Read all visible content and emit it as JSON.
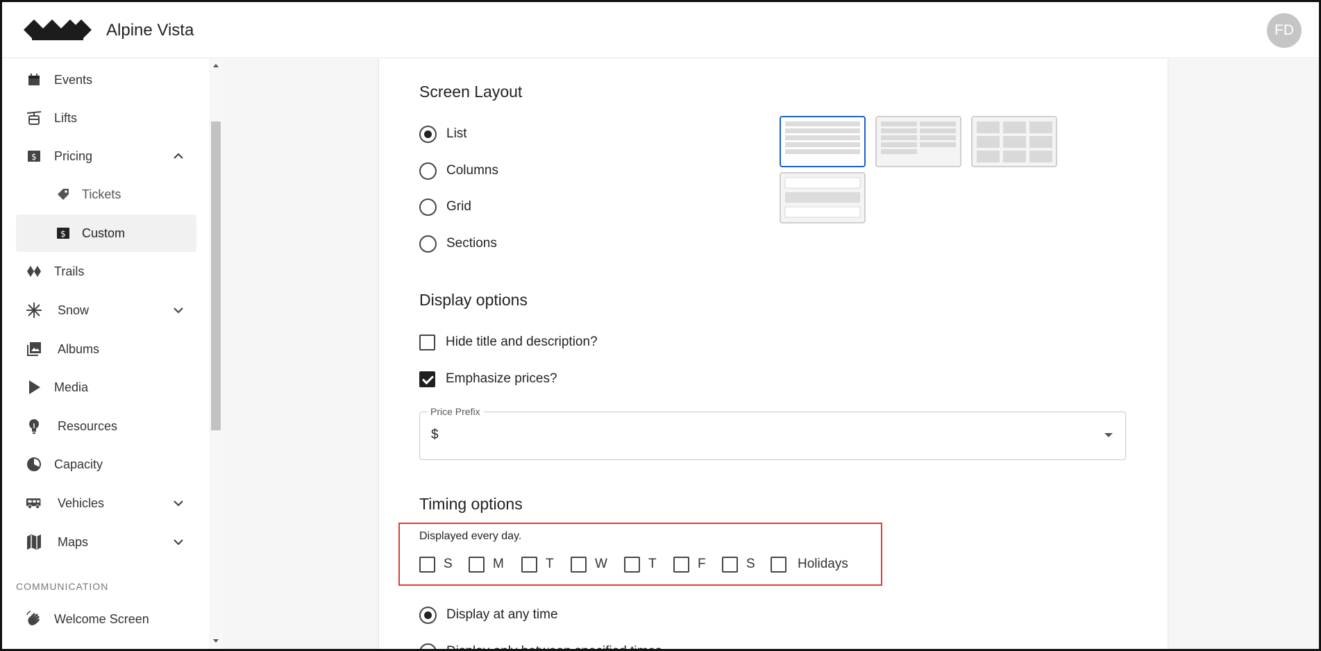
{
  "app": {
    "brand": "Alpine Vista",
    "user_initials": "FD"
  },
  "sidebar": {
    "items": [
      {
        "label": "Events",
        "icon": "calendar-icon"
      },
      {
        "label": "Lifts",
        "icon": "gondola-icon"
      },
      {
        "label": "Pricing",
        "icon": "dollar-icon",
        "expanded": true
      },
      {
        "label": "Tickets",
        "icon": "tag-icon"
      },
      {
        "label": "Custom",
        "icon": "dollar-icon",
        "active": true
      },
      {
        "label": "Trails",
        "icon": "trails-icon"
      },
      {
        "label": "Snow",
        "icon": "snowflake-icon"
      },
      {
        "label": "Albums",
        "icon": "photo-icon"
      },
      {
        "label": "Media",
        "icon": "play-icon"
      },
      {
        "label": "Resources",
        "icon": "lightbulb-icon"
      },
      {
        "label": "Capacity",
        "icon": "gauge-icon"
      },
      {
        "label": "Vehicles",
        "icon": "bus-icon"
      },
      {
        "label": "Maps",
        "icon": "map-icon"
      },
      {
        "label": "Welcome Screen",
        "icon": "wave-icon"
      }
    ],
    "section_communication": "COMMUNICATION"
  },
  "screen_layout": {
    "heading": "Screen Layout",
    "options": [
      "List",
      "Columns",
      "Grid",
      "Sections"
    ],
    "selected": "List"
  },
  "display_options": {
    "heading": "Display options",
    "hide_title": {
      "label": "Hide title and description?",
      "checked": false
    },
    "emphasize": {
      "label": "Emphasize prices?",
      "checked": true
    },
    "price_prefix": {
      "label": "Price Prefix",
      "value": "$"
    }
  },
  "timing": {
    "heading": "Timing options",
    "caption": "Displayed every day.",
    "days": [
      "S",
      "M",
      "T",
      "W",
      "T",
      "F",
      "S",
      "Holidays"
    ],
    "display_any_time": "Display at any time",
    "display_between": "Display only between specified times"
  },
  "colors": {
    "accent": "#1a5fd1",
    "highlight": "#e53935"
  }
}
